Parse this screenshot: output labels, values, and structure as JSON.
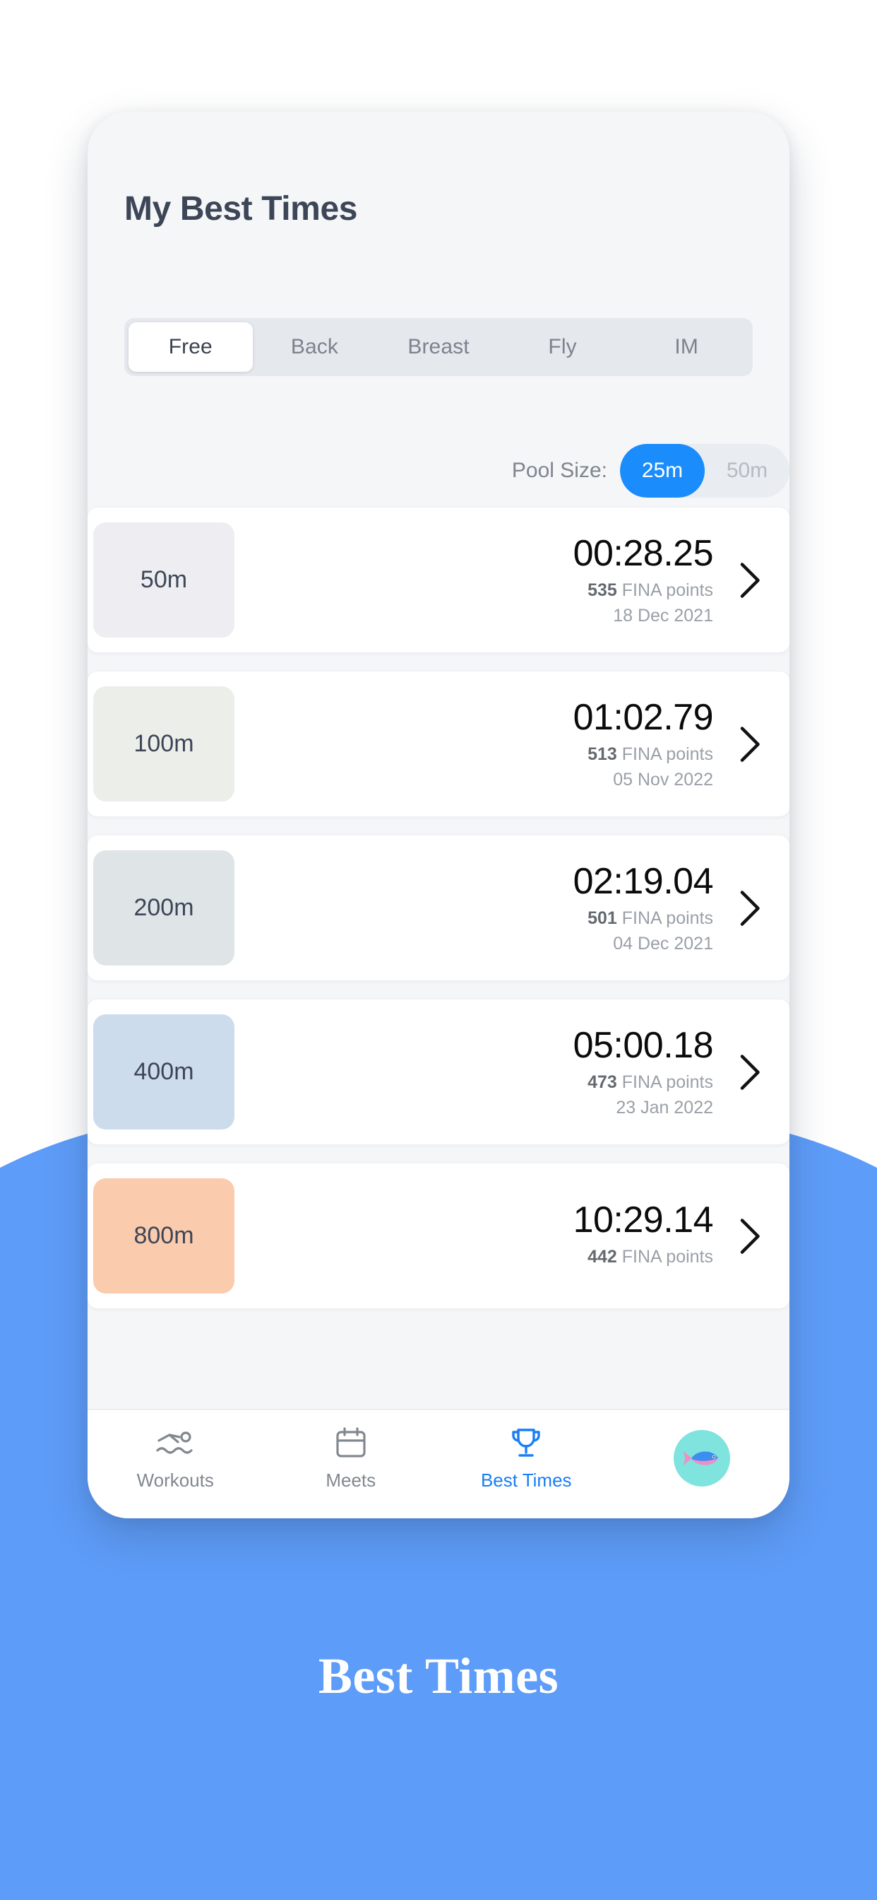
{
  "header": {
    "title": "My Best Times"
  },
  "stroke_tabs": {
    "items": [
      {
        "label": "Free",
        "active": true
      },
      {
        "label": "Back",
        "active": false
      },
      {
        "label": "Breast",
        "active": false
      },
      {
        "label": "Fly",
        "active": false
      },
      {
        "label": "IM",
        "active": false
      }
    ]
  },
  "pool_size": {
    "label": "Pool Size:",
    "options": [
      {
        "label": "25m",
        "active": true
      },
      {
        "label": "50m",
        "active": false
      }
    ]
  },
  "best_times": {
    "points_suffix": "FINA points",
    "rows": [
      {
        "distance": "50m",
        "time": "00:28.25",
        "points": "535",
        "date": "18 Dec 2021",
        "tile_color": "#eeeef2"
      },
      {
        "distance": "100m",
        "time": "01:02.79",
        "points": "513",
        "date": "05 Nov 2022",
        "tile_color": "#eceee9"
      },
      {
        "distance": "200m",
        "time": "02:19.04",
        "points": "501",
        "date": "04 Dec 2021",
        "tile_color": "#dfe4e7"
      },
      {
        "distance": "400m",
        "time": "05:00.18",
        "points": "473",
        "date": "23 Jan 2022",
        "tile_color": "#cddced"
      },
      {
        "distance": "800m",
        "time": "10:29.14",
        "points": "442",
        "date": "",
        "tile_color": "#fbcbad"
      }
    ]
  },
  "tabbar": {
    "items": [
      {
        "label": "Workouts",
        "icon": "swimmer-icon",
        "active": false
      },
      {
        "label": "Meets",
        "icon": "calendar-icon",
        "active": false
      },
      {
        "label": "Best Times",
        "icon": "trophy-icon",
        "active": true
      },
      {
        "label": "",
        "icon": "fish-avatar",
        "active": false
      }
    ]
  },
  "caption": {
    "text": "Best Times"
  },
  "colors": {
    "brand_blue": "#5d9cf8",
    "accent_blue": "#1a8cfb",
    "title_slate": "#3d4657",
    "avatar_bg": "#7fe3de"
  }
}
